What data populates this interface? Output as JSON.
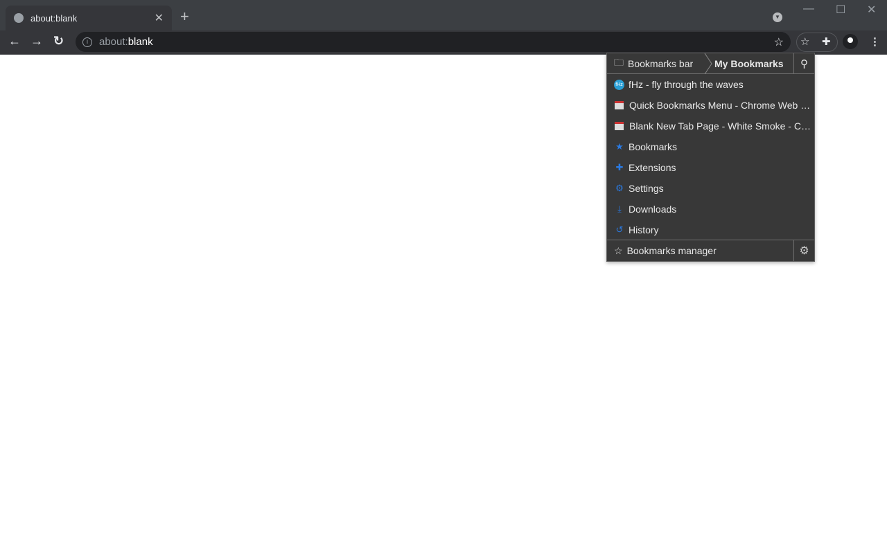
{
  "tab": {
    "title": "about:blank",
    "icon": "globe-icon"
  },
  "omnibox": {
    "host": "about:",
    "path": "blank"
  },
  "menu": {
    "breadcrumbs": [
      "Bookmarks bar",
      "My Bookmarks"
    ],
    "items": [
      {
        "label": "fHz - fly through the waves",
        "icon": "fhz-favicon",
        "favicon_text": "fHz"
      },
      {
        "label": "Quick Bookmarks Menu - Chrome Web Store",
        "icon": "chrome-web-store-icon"
      },
      {
        "label": "Blank New Tab Page - White Smoke - Chrome Web Store",
        "icon": "chrome-web-store-icon"
      },
      {
        "label": "Bookmarks",
        "icon": "star-icon"
      },
      {
        "label": "Extensions",
        "icon": "puzzle-icon"
      },
      {
        "label": "Settings",
        "icon": "gear-icon"
      },
      {
        "label": "Downloads",
        "icon": "download-icon"
      },
      {
        "label": "History",
        "icon": "history-icon"
      }
    ],
    "footer": "Bookmarks manager",
    "accent": "#2a7ae2"
  }
}
